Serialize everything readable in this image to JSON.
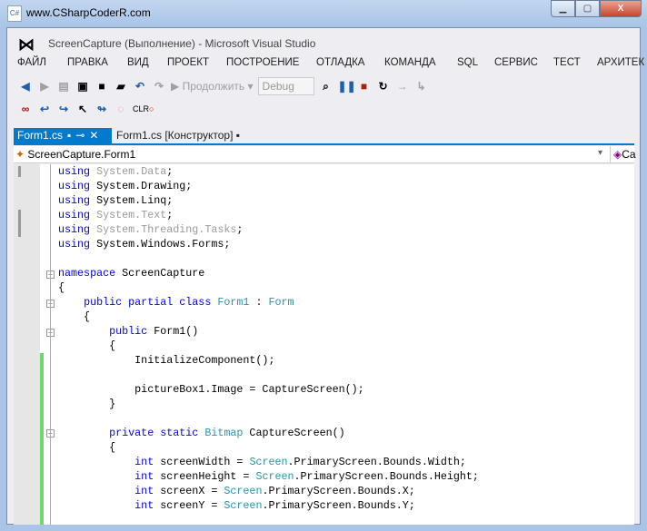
{
  "window": {
    "title": "www.CSharpCoderR.com",
    "min": "▁",
    "max": "▢",
    "close": "X"
  },
  "vs": {
    "title": "ScreenCapture (Выполнение) - Microsoft Visual Studio",
    "menu": [
      "ФАЙЛ",
      "ПРАВКА",
      "ВИД",
      "ПРОЕКТ",
      "ПОСТРОЕНИЕ",
      "ОТЛАДКА",
      "КОМАНДА",
      "SQL",
      "СЕРВИС",
      "ТЕСТ",
      "АРХИТЕК"
    ],
    "toolbar": {
      "continue": "Продолжить",
      "config": "Debug",
      "clr": "CLR"
    },
    "tabs": [
      {
        "label": "Form1.cs",
        "active": true
      },
      {
        "label": "Form1.cs [Конструктор]",
        "active": false
      }
    ],
    "nav": {
      "left": "ScreenCapture.Form1",
      "right": "Ca"
    }
  },
  "code": [
    [
      [
        "using",
        "kw"
      ],
      [
        " ",
        "tx"
      ],
      [
        "System.Data",
        "dim"
      ],
      [
        ";",
        "tx"
      ]
    ],
    [
      [
        "using",
        "kw"
      ],
      [
        " System.Drawing;",
        "tx"
      ]
    ],
    [
      [
        "using",
        "kw"
      ],
      [
        " System.Linq;",
        "tx"
      ]
    ],
    [
      [
        "using",
        "kw"
      ],
      [
        " ",
        "tx"
      ],
      [
        "System.Text",
        "dim"
      ],
      [
        ";",
        "tx"
      ]
    ],
    [
      [
        "using",
        "kw"
      ],
      [
        " ",
        "tx"
      ],
      [
        "System.Threading.Tasks",
        "dim"
      ],
      [
        ";",
        "tx"
      ]
    ],
    [
      [
        "using",
        "kw"
      ],
      [
        " System.Windows.Forms;",
        "tx"
      ]
    ],
    [],
    [
      [
        "namespace",
        "kw"
      ],
      [
        " ScreenCapture",
        "tx"
      ]
    ],
    [
      [
        "{",
        "tx"
      ]
    ],
    [
      [
        "    ",
        "tx"
      ],
      [
        "public partial class",
        "kw"
      ],
      [
        " ",
        "tx"
      ],
      [
        "Form1",
        "ty"
      ],
      [
        " : ",
        "tx"
      ],
      [
        "Form",
        "ty"
      ]
    ],
    [
      [
        "    {",
        "tx"
      ]
    ],
    [
      [
        "        ",
        "tx"
      ],
      [
        "public",
        "kw"
      ],
      [
        " Form1()",
        "tx"
      ]
    ],
    [
      [
        "        {",
        "tx"
      ]
    ],
    [
      [
        "            InitializeComponent();",
        "tx"
      ]
    ],
    [],
    [
      [
        "            pictureBox1.Image = CaptureScreen();",
        "tx"
      ]
    ],
    [
      [
        "        }",
        "tx"
      ]
    ],
    [],
    [
      [
        "        ",
        "tx"
      ],
      [
        "private static",
        "kw"
      ],
      [
        " ",
        "tx"
      ],
      [
        "Bitmap",
        "ty"
      ],
      [
        " CaptureScreen()",
        "tx"
      ]
    ],
    [
      [
        "        {",
        "tx"
      ]
    ],
    [
      [
        "            ",
        "tx"
      ],
      [
        "int",
        "kw"
      ],
      [
        " screenWidth = ",
        "tx"
      ],
      [
        "Screen",
        "ty"
      ],
      [
        ".PrimaryScreen.Bounds.Width;",
        "tx"
      ]
    ],
    [
      [
        "            ",
        "tx"
      ],
      [
        "int",
        "kw"
      ],
      [
        " screenHeight = ",
        "tx"
      ],
      [
        "Screen",
        "ty"
      ],
      [
        ".PrimaryScreen.Bounds.Height;",
        "tx"
      ]
    ],
    [
      [
        "            ",
        "tx"
      ],
      [
        "int",
        "kw"
      ],
      [
        " screenX = ",
        "tx"
      ],
      [
        "Screen",
        "ty"
      ],
      [
        ".PrimaryScreen.Bounds.X;",
        "tx"
      ]
    ],
    [
      [
        "            ",
        "tx"
      ],
      [
        "int",
        "kw"
      ],
      [
        " screenY = ",
        "tx"
      ],
      [
        "Screen",
        "ty"
      ],
      [
        ".PrimaryScreen.Bounds.Y;",
        "tx"
      ]
    ]
  ],
  "colors": {
    "accent": "#007acc",
    "keyword": "#0000ff",
    "type": "#2b91af",
    "changed": "#6cd96c"
  }
}
